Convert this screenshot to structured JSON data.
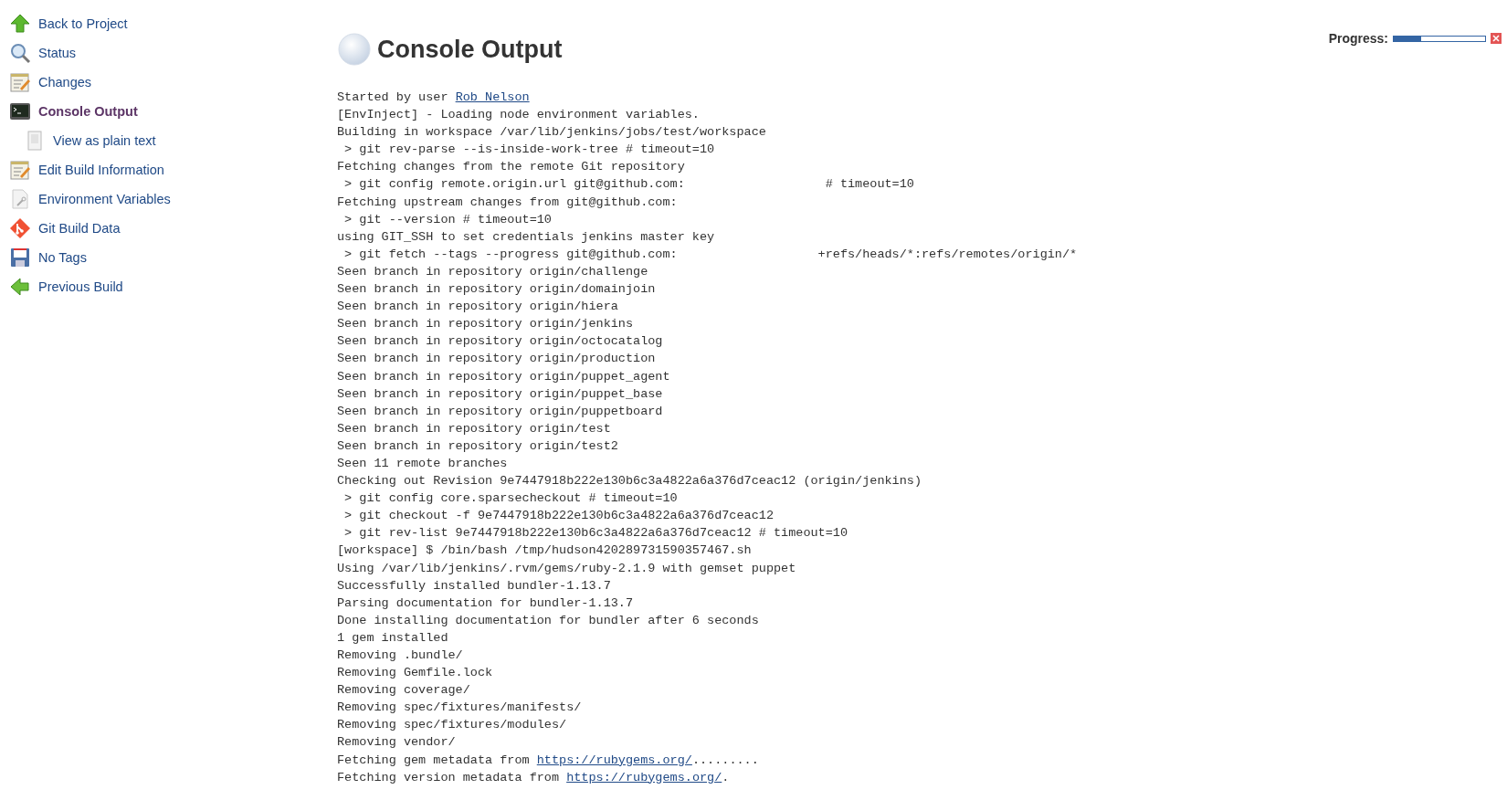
{
  "sidebar": {
    "items": [
      {
        "label": "Back to Project",
        "kind": "up-arrow",
        "selected": false
      },
      {
        "label": "Status",
        "kind": "magnifier",
        "selected": false
      },
      {
        "label": "Changes",
        "kind": "notepad",
        "selected": false
      },
      {
        "label": "Console Output",
        "kind": "terminal",
        "selected": true,
        "children": [
          {
            "label": "View as plain text",
            "kind": "page",
            "selected": false
          }
        ]
      },
      {
        "label": "Edit Build Information",
        "kind": "notepad",
        "selected": false
      },
      {
        "label": "Environment Variables",
        "kind": "page-wrench",
        "selected": false
      },
      {
        "label": "Git Build Data",
        "kind": "git",
        "selected": false
      },
      {
        "label": "No Tags",
        "kind": "floppy",
        "selected": false
      },
      {
        "label": "Previous Build",
        "kind": "left-arrow",
        "selected": false
      }
    ]
  },
  "header": {
    "title": "Console Output"
  },
  "progress": {
    "label": "Progress:",
    "level": 0.3
  },
  "console": {
    "lines": [
      [
        {
          "text": "Started by user "
        },
        {
          "text": "Rob Nelson",
          "kind": "link"
        }
      ],
      "[EnvInject] - Loading node environment variables.",
      "Building in workspace /var/lib/jenkins/jobs/test/workspace",
      " > git rev-parse --is-inside-work-tree # timeout=10",
      "Fetching changes from the remote Git repository",
      " > git config remote.origin.url git@github.com:                   # timeout=10",
      "Fetching upstream changes from git@github.com:",
      " > git --version # timeout=10",
      "using GIT_SSH to set credentials jenkins master key",
      " > git fetch --tags --progress git@github.com:                   +refs/heads/*:refs/remotes/origin/*",
      "Seen branch in repository origin/challenge",
      "Seen branch in repository origin/domainjoin",
      "Seen branch in repository origin/hiera",
      "Seen branch in repository origin/jenkins",
      "Seen branch in repository origin/octocatalog",
      "Seen branch in repository origin/production",
      "Seen branch in repository origin/puppet_agent",
      "Seen branch in repository origin/puppet_base",
      "Seen branch in repository origin/puppetboard",
      "Seen branch in repository origin/test",
      "Seen branch in repository origin/test2",
      "Seen 11 remote branches",
      "Checking out Revision 9e7447918b222e130b6c3a4822a6a376d7ceac12 (origin/jenkins)",
      " > git config core.sparsecheckout # timeout=10",
      " > git checkout -f 9e7447918b222e130b6c3a4822a6a376d7ceac12",
      " > git rev-list 9e7447918b222e130b6c3a4822a6a376d7ceac12 # timeout=10",
      "[workspace] $ /bin/bash /tmp/hudson420289731590357467.sh",
      "Using /var/lib/jenkins/.rvm/gems/ruby-2.1.9 with gemset puppet",
      "Successfully installed bundler-1.13.7",
      "Parsing documentation for bundler-1.13.7",
      "Done installing documentation for bundler after 6 seconds",
      "1 gem installed",
      "Removing .bundle/",
      "Removing Gemfile.lock",
      "Removing coverage/",
      "Removing spec/fixtures/manifests/",
      "Removing spec/fixtures/modules/",
      "Removing vendor/",
      [
        {
          "text": "Fetching gem metadata from "
        },
        {
          "text": "https://rubygems.org/",
          "kind": "link"
        },
        {
          "text": "........."
        }
      ],
      [
        {
          "text": "Fetching version metadata from "
        },
        {
          "text": "https://rubygems.org/",
          "kind": "link"
        },
        {
          "text": "."
        }
      ]
    ]
  }
}
